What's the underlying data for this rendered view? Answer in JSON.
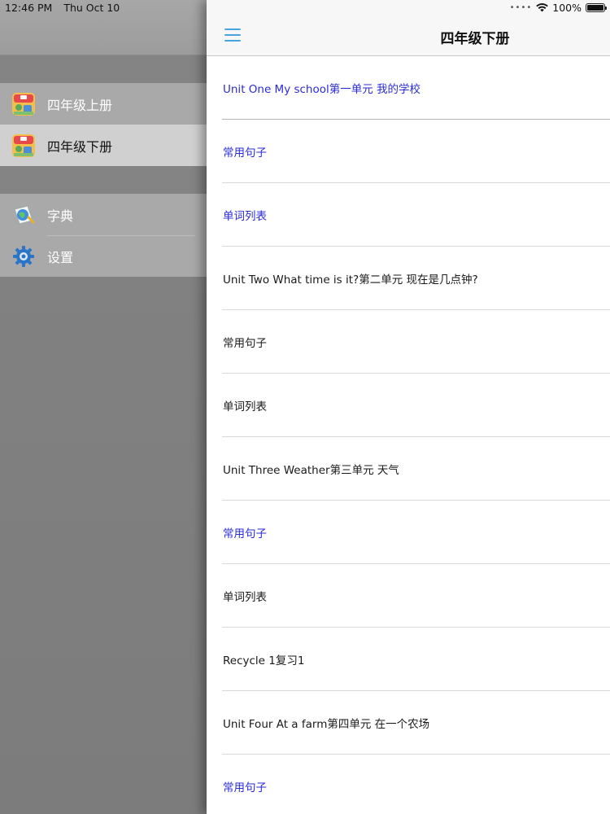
{
  "status_bar": {
    "time": "12:46 PM",
    "date": "Thu Oct 10",
    "battery": "100%",
    "icons": [
      "wifi-icon",
      "battery-icon"
    ]
  },
  "drawer": {
    "books": [
      {
        "label": "四年级上册",
        "icon": "book-cover-icon",
        "selected": false
      },
      {
        "label": "四年级下册",
        "icon": "book-cover-icon",
        "selected": true
      }
    ],
    "tools": [
      {
        "label": "字典",
        "icon": "dictionary-globe-icon"
      },
      {
        "label": "设置",
        "icon": "gear-icon"
      }
    ]
  },
  "header": {
    "title": "四年级下册",
    "menu_icon": "hamburger-menu-icon"
  },
  "list": [
    {
      "label": "Unit One My school第一单元 我的学校",
      "style": "link"
    },
    {
      "label": "常用句子",
      "style": "link"
    },
    {
      "label": "单词列表",
      "style": "link"
    },
    {
      "label": "Unit Two What time is it?第二单元 现在是几点钟?",
      "style": "plain"
    },
    {
      "label": "常用句子",
      "style": "plain"
    },
    {
      "label": "单词列表",
      "style": "plain"
    },
    {
      "label": "Unit Three Weather第三单元 天气",
      "style": "plain"
    },
    {
      "label": "常用句子",
      "style": "link"
    },
    {
      "label": "单词列表",
      "style": "plain"
    },
    {
      "label": "Recycle 1复习1",
      "style": "plain"
    },
    {
      "label": "Unit Four At a farm第四单元 在一个农场",
      "style": "plain"
    },
    {
      "label": "常用句子",
      "style": "link"
    }
  ],
  "colors": {
    "link_text": "#2b2bd6",
    "menu_icon": "#4aa3e0",
    "selected_drawer_bg": "#d0d0d0"
  }
}
